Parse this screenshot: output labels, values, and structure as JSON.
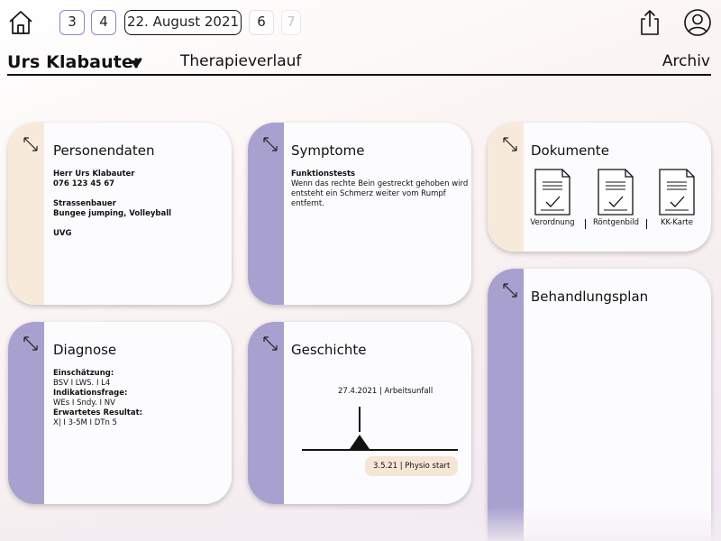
{
  "topbar": {
    "days": [
      {
        "label": "3",
        "kind": "chip"
      },
      {
        "label": "4",
        "kind": "chip"
      },
      {
        "label": "22. August 2021",
        "kind": "date"
      },
      {
        "label": "6",
        "kind": "plain"
      },
      {
        "label": "7",
        "kind": "fade"
      }
    ],
    "icons": {
      "home": "home-icon",
      "share": "share-icon",
      "profile": "user-profile-icon"
    }
  },
  "header": {
    "patient_name": "Urs Klabauter",
    "tab_therapie": "Therapieverlauf",
    "tab_archiv": "Archiv"
  },
  "colors": {
    "accent_lavender": "#a8a1cf",
    "accent_peach": "#f8eadb",
    "chip_border": "#8e87c4"
  },
  "cards": {
    "personendaten": {
      "title": "Personendaten",
      "lines": [
        "Herr Urs Klabauter",
        "076 123 45 67",
        "",
        "Strassenbauer",
        "Bungee jumping, Volleyball",
        "",
        "UVG"
      ]
    },
    "symptome": {
      "title": "Symptome",
      "heading": "Funktionstests",
      "text": [
        "Wenn das rechte Bein gestreckt gehoben wird",
        "entsteht ein Schmerz weiter vom Rumpf",
        "entfernt."
      ]
    },
    "dokumente": {
      "title": "Dokumente",
      "items": [
        "Verordnung",
        "Röntgenbild",
        "KK-Karte"
      ]
    },
    "diagnose": {
      "title": "Diagnose",
      "einschaetzung_label": "Einschätzung:",
      "einschaetzung": "BSV I LWS. I L4",
      "indikation_label": "Indikationsfrage:",
      "indikation": "WEs I Sndy. I NV",
      "resultat_label": "Erwartetes Resultat:",
      "resultat": "X| I 3-5M I DTn 5"
    },
    "geschichte": {
      "title": "Geschichte",
      "event1": "27.4.2021 | Arbeitsunfall",
      "event2": "3.5.21 | Physio start"
    },
    "behandlungsplan": {
      "title": "Behandlungsplan"
    }
  }
}
